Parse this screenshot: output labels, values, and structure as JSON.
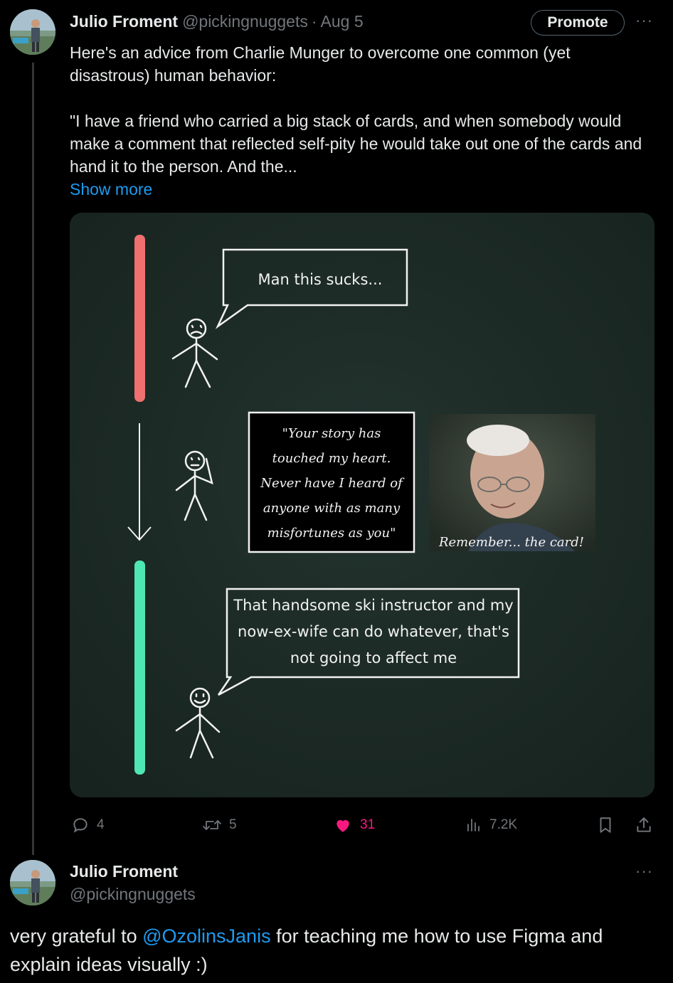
{
  "tweet": {
    "author_name": "Julio Froment",
    "author_handle": "@pickingnuggets",
    "separator": "·",
    "date": "Aug 5",
    "promote_label": "Promote",
    "more_label": "···",
    "text_p1": "Here's an advice from Charlie Munger to overcome one common (yet disastrous) human behavior:",
    "text_p2": "\"I have a friend who carried a big stack of cards, and when somebody would make a comment that reflected self-pity he would take out one of the cards and hand it to the person. And the...",
    "show_more": "Show more",
    "image": {
      "bubble_top": "Man this sucks...",
      "card_lines": [
        "\"Your story has",
        "touched my heart.",
        "Never have I heard of",
        "anyone with as many",
        "misfortunes as you\""
      ],
      "photo_caption": "Remember... the card!",
      "bubble_bottom_lines": [
        "That handsome ski instructor and my",
        "now-ex-wife can do whatever, that's",
        "not going to affect me"
      ],
      "colors": {
        "bad": "#f07070",
        "good": "#4ee6b3",
        "board": "#1d2b27"
      }
    },
    "actions": {
      "replies": "4",
      "reposts": "5",
      "likes": "31",
      "views": "7.2K"
    }
  },
  "reply": {
    "author_name": "Julio Froment",
    "author_handle": "@pickingnuggets",
    "more_label": "···",
    "text_before": "very grateful to ",
    "mention": "@OzolinsJanis",
    "text_after": " for teaching me how to use Figma and explain ideas visually :)"
  },
  "colors": {
    "accent": "#1d9bf0",
    "like": "#f91880",
    "muted": "#71767b"
  }
}
